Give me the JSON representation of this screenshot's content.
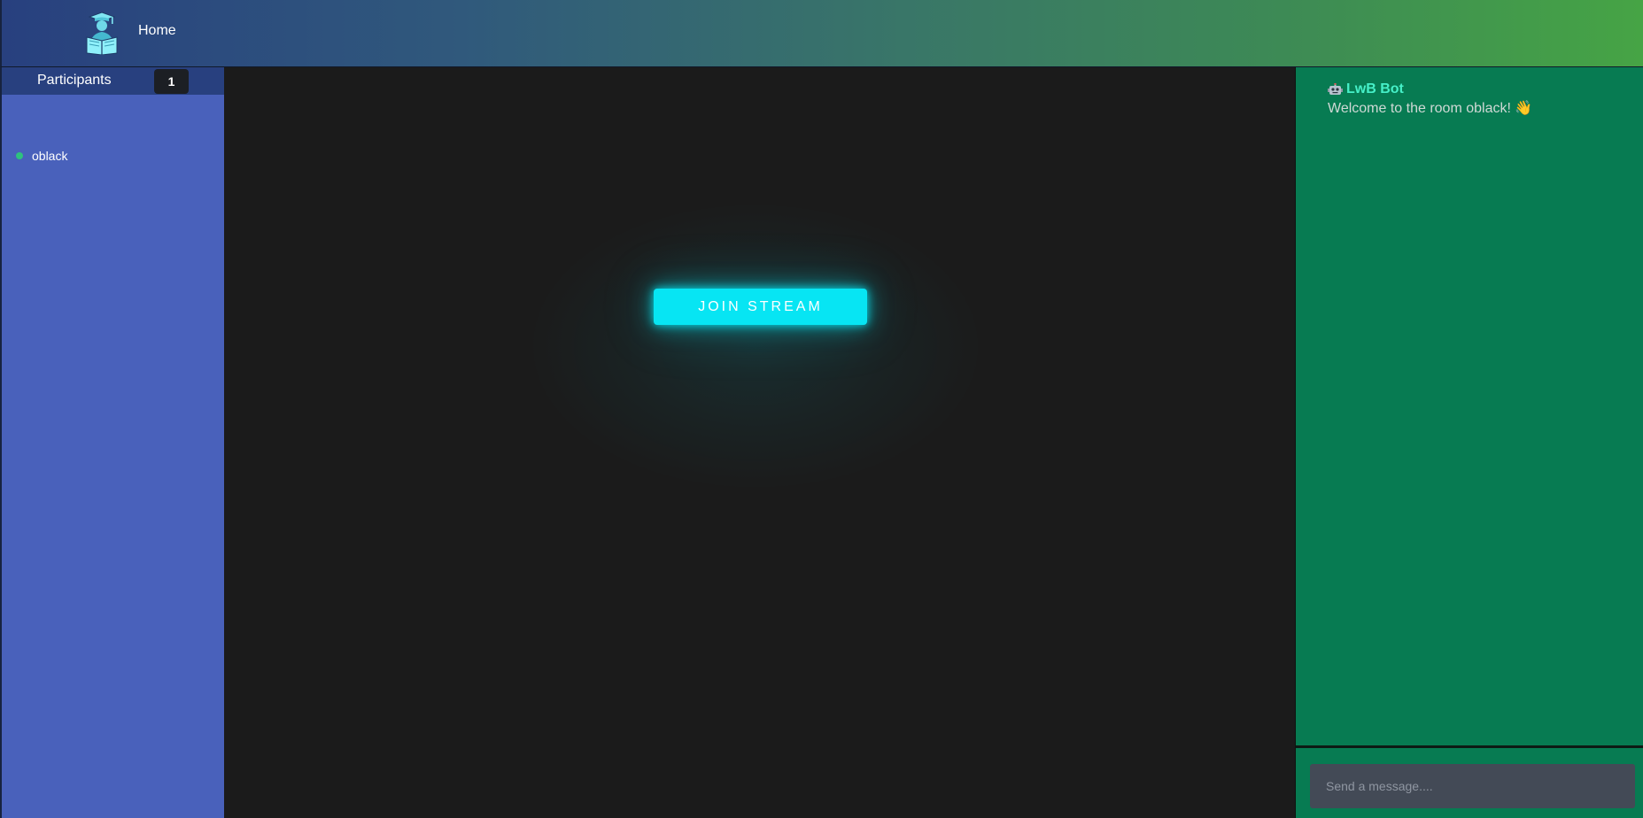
{
  "topbar": {
    "logo_icon": "student-reading-book-icon",
    "home_label": "Home"
  },
  "sidebar": {
    "title": "Participants",
    "count": "1",
    "participants": [
      {
        "name": "oblack",
        "status": "online",
        "status_color": "#2ec27e"
      }
    ]
  },
  "stage": {
    "join_label": "JOIN STREAM",
    "accent_color": "#07e5f3"
  },
  "chat": {
    "messages": [
      {
        "sender_icon": "robot-icon",
        "sender": "LwB Bot",
        "text": "Welcome to the room oblack!",
        "emoji": "👋"
      }
    ],
    "input_placeholder": "Send a message...."
  }
}
